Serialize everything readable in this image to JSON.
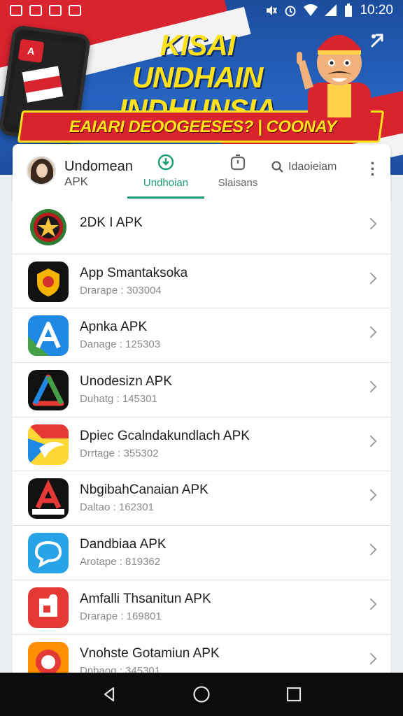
{
  "status_bar": {
    "time": "10:20"
  },
  "banner": {
    "phone_logo": "A",
    "title": "KISAI UNDHAIN INDHUNSIA",
    "subtitle": "EAIARI DEOOGEESES? | COONAY APODIEAON.!"
  },
  "header": {
    "app_title": "Undomean",
    "app_subtitle": "APK",
    "tabs": [
      {
        "label": "Undhoian",
        "icon": "download-icon",
        "active": true
      },
      {
        "label": "Slaisans",
        "icon": "timer-icon",
        "active": false
      }
    ],
    "search_label": "Idaoieiam",
    "accent_color": "#1a9b70"
  },
  "apps": [
    {
      "name": "2DK I APK",
      "meta": "",
      "icon": "star-emblem-icon"
    },
    {
      "name": "App Smantaksoka",
      "meta": "Drarape : 303004",
      "icon": "shield-icon"
    },
    {
      "name": "Apnka APK",
      "meta": "Danage : 125303",
      "icon": "a-letter-icon"
    },
    {
      "name": "Unodesizn APK",
      "meta": "Duhatg : 145301",
      "icon": "triangle-logo-icon"
    },
    {
      "name": "Dpiec Gcalndakundlach APK",
      "meta": "Drrtage : 355302",
      "icon": "swoosh-logo-icon"
    },
    {
      "name": "NbgibahCanaian APK",
      "meta": "Daltao : 162301",
      "icon": "a-badge-icon"
    },
    {
      "name": "Dandbiaa APK",
      "meta": "Arotape : 819362",
      "icon": "chat-bubble-icon"
    },
    {
      "name": "Amfalli Thsanitun APK",
      "meta": "Drarape : 169801",
      "icon": "puzzle-icon"
    },
    {
      "name": "Vnohste Gotamiun APK",
      "meta": "Dnhaog : 345301",
      "icon": "ring-logo-icon"
    }
  ]
}
